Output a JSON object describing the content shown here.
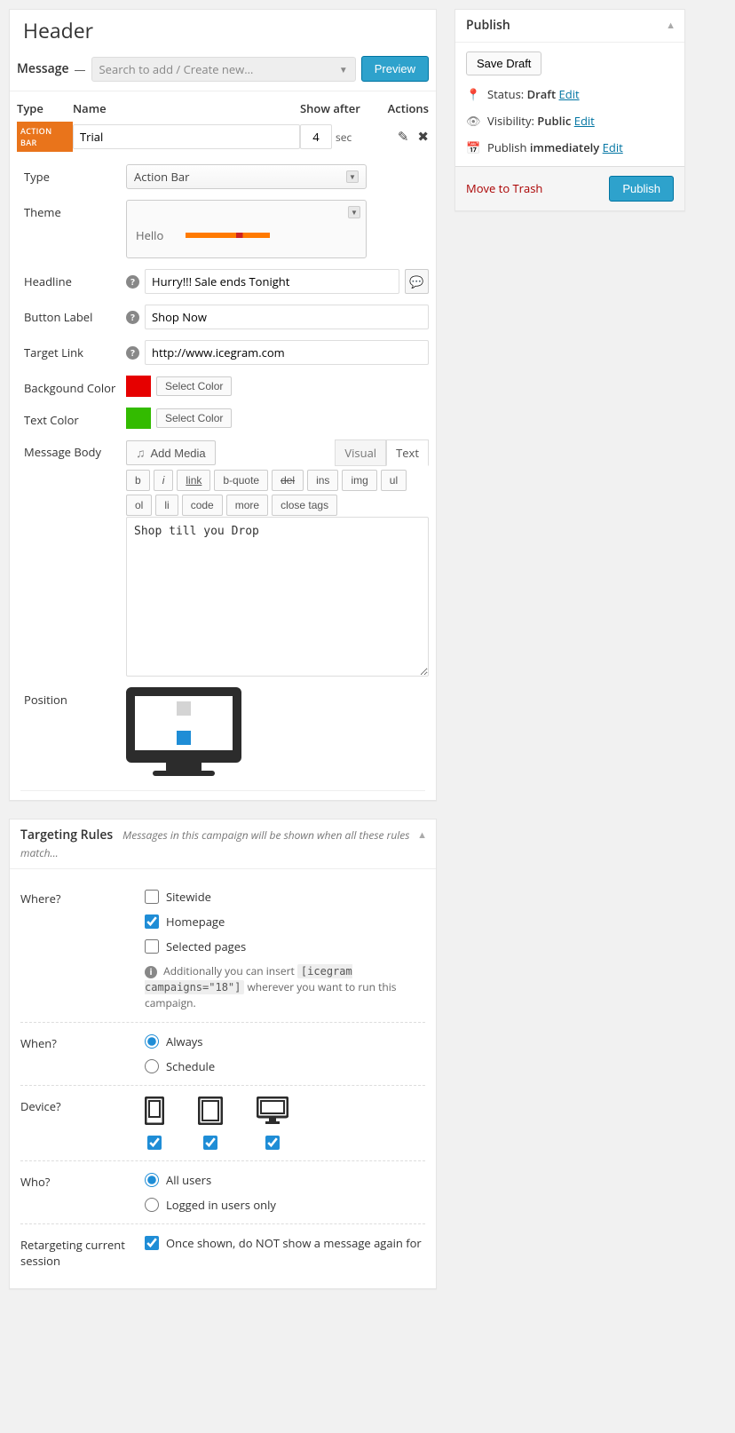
{
  "header": {
    "title": "Header"
  },
  "message_panel": {
    "label": "Message",
    "search_placeholder": "Search to add / Create new…",
    "preview_btn": "Preview",
    "cols": {
      "type": "Type",
      "name": "Name",
      "show_after": "Show after",
      "actions": "Actions"
    },
    "row": {
      "badge": "ACTION BAR",
      "name_val": "Trial",
      "show_after_val": "4",
      "sec_label": "sec"
    },
    "form": {
      "type_label": "Type",
      "type_value": "Action Bar",
      "theme_label": "Theme",
      "theme_value": "Hello",
      "headline_label": "Headline",
      "headline_val": "Hurry!!! Sale ends Tonight",
      "button_label_label": "Button Label",
      "button_label_val": "Shop Now",
      "target_link_label": "Target Link",
      "target_link_val": "http://www.icegram.com",
      "bg_color_label": "Backgound Color",
      "text_color_label": "Text Color",
      "select_color_btn": "Select Color",
      "msg_body_label": "Message Body",
      "add_media_btn": "Add Media",
      "tabs": {
        "visual": "Visual",
        "text": "Text"
      },
      "toolbar": [
        "b",
        "i",
        "link",
        "b-quote",
        "del",
        "ins",
        "img",
        "ul",
        "ol",
        "li",
        "code",
        "more",
        "close tags"
      ],
      "body_text": "Shop till you Drop",
      "position_label": "Position"
    }
  },
  "targeting": {
    "title": "Targeting Rules",
    "subtitle": "Messages in this campaign will be shown when all these rules match...",
    "where": {
      "label": "Where?",
      "sitewide": "Sitewide",
      "homepage": "Homepage",
      "selected": "Selected pages",
      "note_prefix": "Additionally you can insert ",
      "note_code": "[icegram campaigns=\"18\"]",
      "note_suffix": " wherever you want to run this campaign."
    },
    "when": {
      "label": "When?",
      "always": "Always",
      "schedule": "Schedule"
    },
    "device": {
      "label": "Device?"
    },
    "who": {
      "label": "Who?",
      "all": "All users",
      "logged_in": "Logged in users only"
    },
    "retarget": {
      "label": "Retargeting current session",
      "text": "Once shown, do NOT show a message again for"
    }
  },
  "publish": {
    "title": "Publish",
    "save_draft": "Save Draft",
    "status_label": "Status:",
    "status_val": "Draft",
    "visibility_label": "Visibility:",
    "visibility_val": "Public",
    "publish_label": "Publish",
    "publish_val": "immediately",
    "edit_link": "Edit",
    "trash": "Move to Trash",
    "publish_btn": "Publish"
  }
}
